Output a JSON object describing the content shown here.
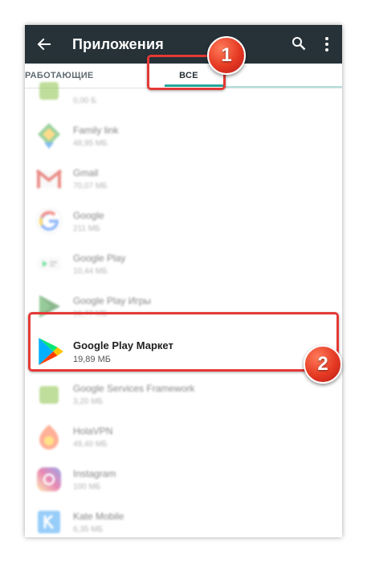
{
  "appbar": {
    "title": "Приложения",
    "back_icon": "arrow-back-icon",
    "search_icon": "search-icon",
    "more_icon": "more-vert-icon",
    "background": "#263238"
  },
  "tabs": {
    "running_label": "РАБОТАЮЩИЕ",
    "all_label": "ВСЕ",
    "accent": "#26a69a"
  },
  "apps": [
    {
      "name": "",
      "size": "0,00 Б",
      "icon": "android-icon",
      "blurred": true
    },
    {
      "name": "Family link",
      "size": "48,95 МБ",
      "icon": "family-link-icon",
      "blurred": true
    },
    {
      "name": "Gmail",
      "size": "70,07 МБ",
      "icon": "gmail-icon",
      "blurred": true
    },
    {
      "name": "Google",
      "size": "211 МБ",
      "icon": "google-icon",
      "blurred": true
    },
    {
      "name": "Google Play",
      "size": "10,44 МБ",
      "icon": "google-play-icon",
      "blurred": true
    },
    {
      "name": "Google Play Игры",
      "size": "16,77 МБ",
      "icon": "play-games-icon",
      "blurred": true
    },
    {
      "name": "Google Play Маркет",
      "size": "19,89 МБ",
      "icon": "play-store-icon",
      "blurred": false
    },
    {
      "name": "Google Services Framework",
      "size": "3,20 МБ",
      "icon": "android-icon",
      "blurred": true
    },
    {
      "name": "HolaVPN",
      "size": "49,40 МБ",
      "icon": "hola-icon",
      "blurred": true
    },
    {
      "name": "Instagram",
      "size": "100 МБ",
      "icon": "instagram-icon",
      "blurred": true
    },
    {
      "name": "Kate Mobile",
      "size": "6,35 МБ",
      "icon": "kate-mobile-icon",
      "blurred": true
    }
  ],
  "callouts": {
    "first": "1",
    "second": "2",
    "color": "#e53935"
  }
}
